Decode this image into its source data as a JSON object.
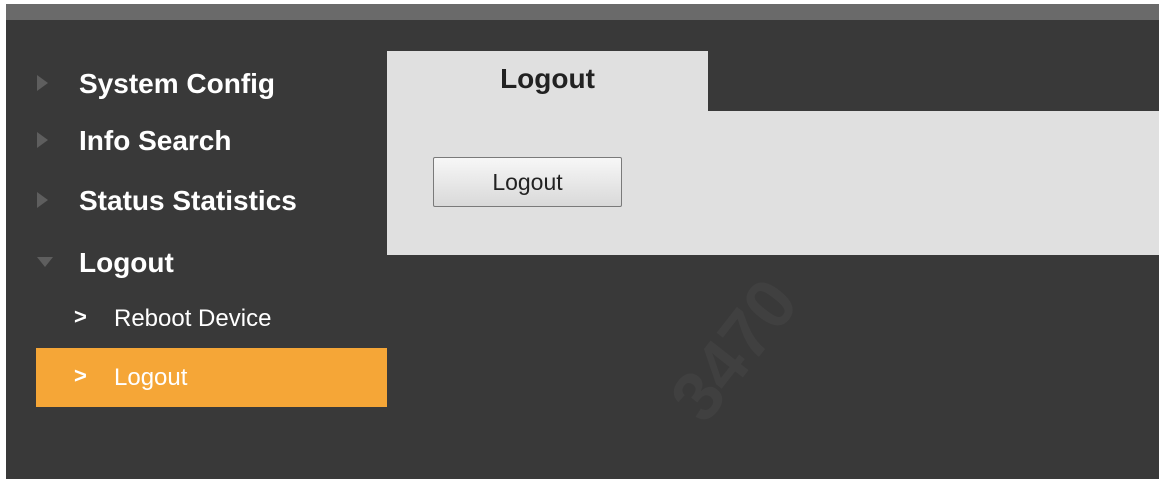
{
  "sidebar": {
    "groups": [
      {
        "label": "System Config",
        "expanded": false
      },
      {
        "label": "Info Search",
        "expanded": false
      },
      {
        "label": "Status Statistics",
        "expanded": false
      },
      {
        "label": "Logout",
        "expanded": true
      }
    ],
    "subitems": [
      {
        "label": "Reboot Device",
        "active": false
      },
      {
        "label": "Logout",
        "active": true
      }
    ],
    "chevron": ">",
    "icons": {
      "collapsed": "triangle-right-icon",
      "expanded": "triangle-down-icon",
      "subitem": "chevron-right-icon"
    }
  },
  "content": {
    "tab_label": "Logout",
    "button_label": "Logout"
  },
  "colors": {
    "background": "#393939",
    "accent": "#f5a637",
    "panel": "#e0e0e0"
  }
}
